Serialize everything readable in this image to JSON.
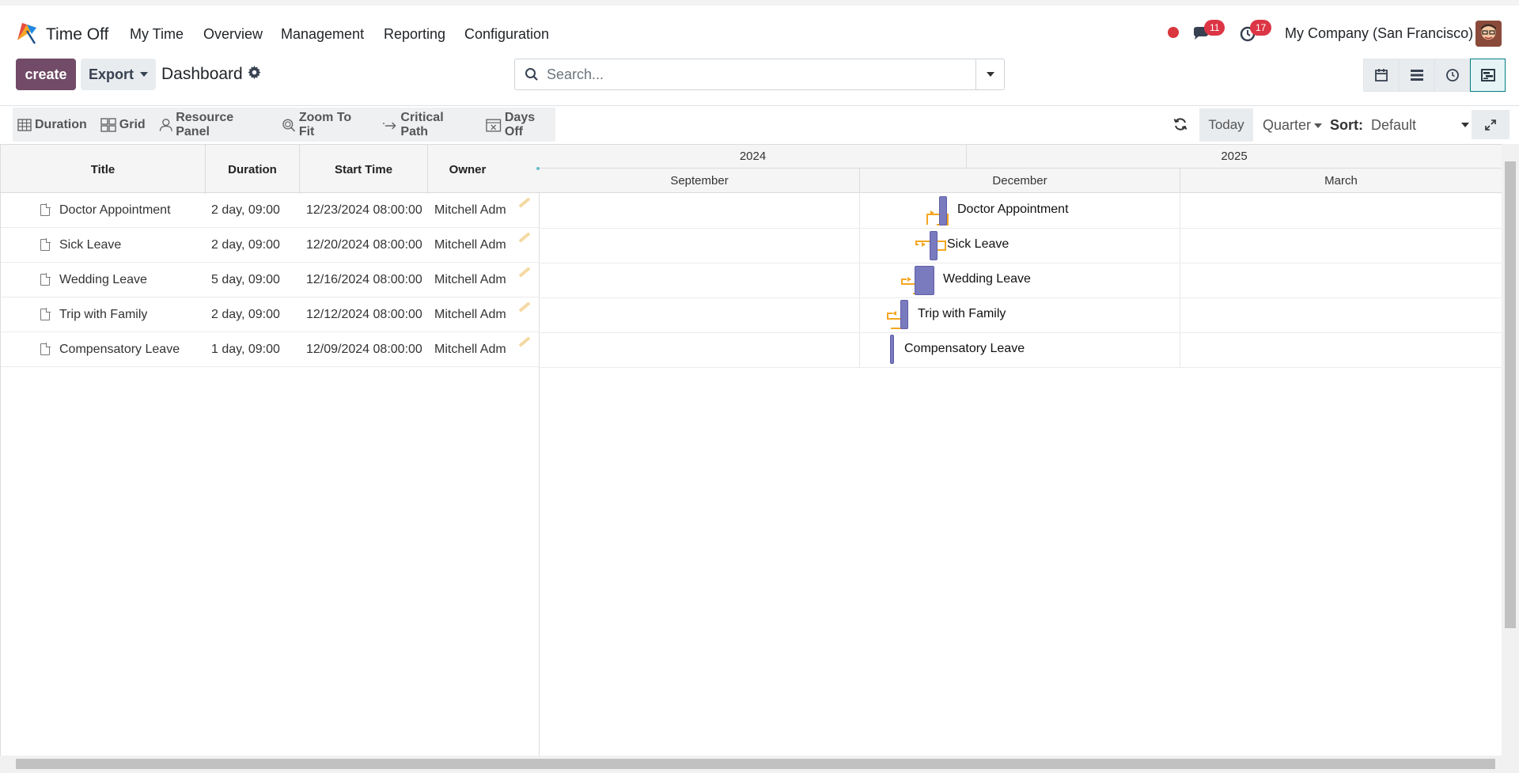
{
  "app": {
    "name": "Time Off"
  },
  "menu": [
    "My Time",
    "Overview",
    "Management",
    "Reporting",
    "Configuration"
  ],
  "systray": {
    "messages_count": "11",
    "activities_count": "17",
    "company": "My Company (San Francisco)"
  },
  "control": {
    "create_label": "create",
    "export_label": "Export",
    "breadcrumb": "Dashboard",
    "search_placeholder": "Search..."
  },
  "gantt_toolbar": {
    "items": [
      "Duration",
      "Grid",
      "Resource Panel",
      "Zoom To Fit",
      "Critical Path",
      "Days Off"
    ],
    "today_label": "Today",
    "scale_label": "Quarter",
    "sort_label": "Sort:",
    "sort_value": "Default"
  },
  "grid": {
    "columns": [
      "Title",
      "Duration",
      "Start Time",
      "Owner"
    ],
    "rows": [
      {
        "title": "Doctor Appointment",
        "duration": "2 day, 09:00",
        "start": "12/23/2024 08:00:00",
        "owner": "Mitchell Adm"
      },
      {
        "title": "Sick Leave",
        "duration": "2 day, 09:00",
        "start": "12/20/2024 08:00:00",
        "owner": "Mitchell Adm"
      },
      {
        "title": "Wedding Leave",
        "duration": "5 day, 09:00",
        "start": "12/16/2024 08:00:00",
        "owner": "Mitchell Adm"
      },
      {
        "title": "Trip with Family",
        "duration": "2 day, 09:00",
        "start": "12/12/2024 08:00:00",
        "owner": "Mitchell Adm"
      },
      {
        "title": "Compensatory Leave",
        "duration": "1 day, 09:00",
        "start": "12/09/2024 08:00:00",
        "owner": "Mitchell Adm"
      }
    ]
  },
  "timeline": {
    "years": [
      "2024",
      "2025"
    ],
    "months": [
      "September",
      "December",
      "March"
    ]
  },
  "colors": {
    "brand": "#714b67",
    "bar": "#7a7abf",
    "link": "#f5a623",
    "active_view": "#017e84"
  }
}
